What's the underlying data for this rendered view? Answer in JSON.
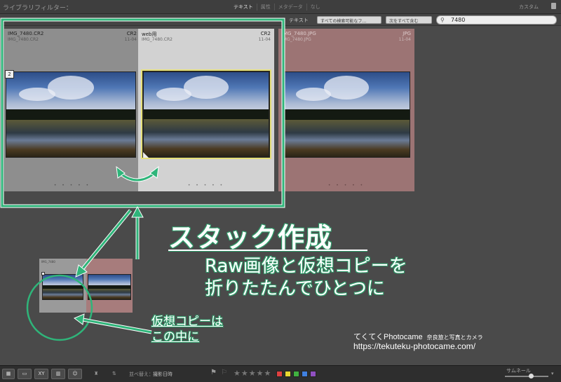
{
  "filter_bar": {
    "title": "ライブラリフィルター：",
    "tabs": [
      "テキスト",
      "属性",
      "メタデータ",
      "なし"
    ],
    "preset": "カスタム"
  },
  "search_bar": {
    "label": "テキスト",
    "field_select": "すべての検索可能なフ…",
    "rule_select": "次をすべて含む",
    "query": "7480"
  },
  "cells": [
    {
      "filename": "IMG_7480.CR2",
      "subname": "IMG_7480.CR2",
      "ext": "CR2",
      "date": "11-04",
      "stack_count": "2",
      "dots": "• • • • •"
    },
    {
      "filename": "web用",
      "subname": "IMG_7480.CR2",
      "ext": "CR2",
      "date": "11-04",
      "dots": "• • • • •"
    },
    {
      "filename": "IMG_7480.JPG",
      "subname": "IMG_7480.JPG",
      "ext": "JPG",
      "date": "11-04",
      "dots": "• • • • •"
    }
  ],
  "mini": {
    "label": "IMG_7480"
  },
  "annotations": {
    "title": "スタック作成",
    "desc_line1": "Raw画像と仮想コピーを",
    "desc_line2": "折りたたんでひとつに",
    "vc_line1": "仮想コピーは",
    "vc_line2": "この中に",
    "watermark_name": "てくてくPhotocame",
    "watermark_tag": "奈良旅と写真とカメラ",
    "watermark_url": "https://tekuteku-photocame.com/"
  },
  "toolbar": {
    "sort_label": "並べ替え：",
    "sort_value": "撮影日時",
    "stars": "★★★★★",
    "thumb_label": "サムネール",
    "thumb_level": 0.6,
    "swatch_colors": [
      "#e04040",
      "#e8d830",
      "#40b040",
      "#4080e0",
      "#9050c0"
    ]
  },
  "colors": {
    "accent": "#2f9e6b",
    "selected_cell": "#d2d2d2",
    "copy_cell": "#9c7474"
  }
}
